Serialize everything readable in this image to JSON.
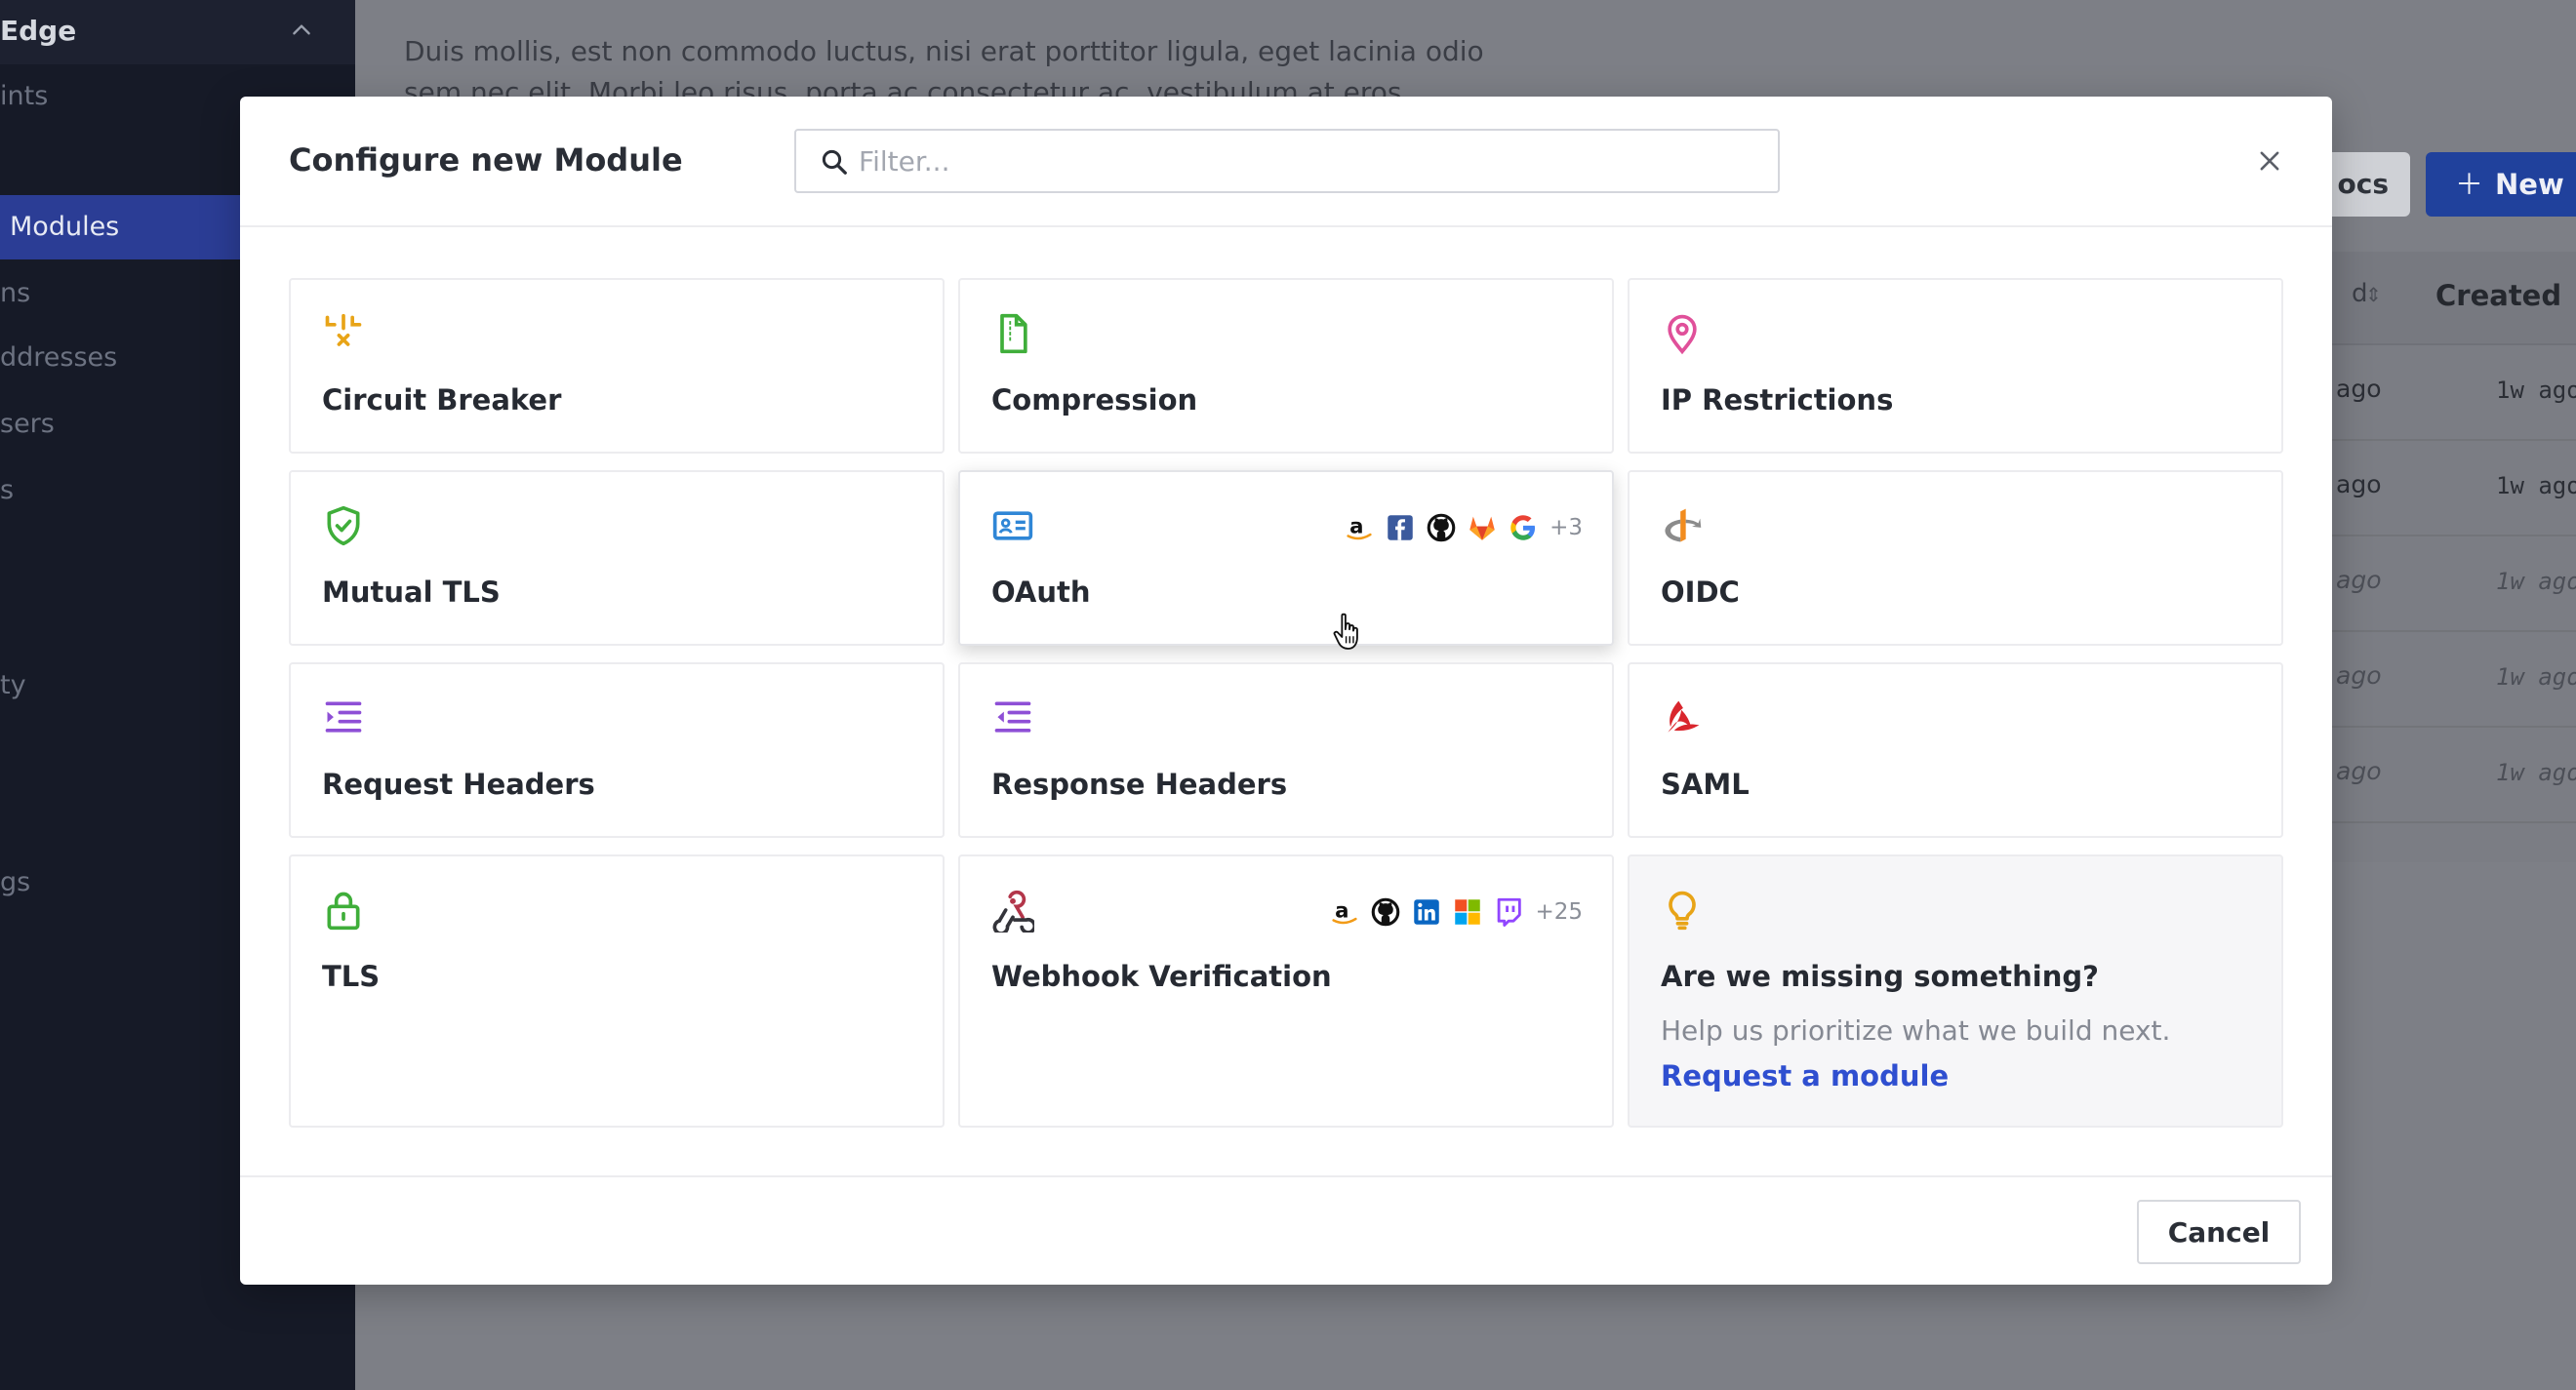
{
  "background": {
    "sidebar": {
      "header_title": "Edge",
      "items": [
        {
          "label": "ints"
        },
        {
          "label": "Modules",
          "active": true
        },
        {
          "label": "ns"
        },
        {
          "label": "ddresses"
        },
        {
          "label": "sers"
        },
        {
          "label": "s"
        },
        {
          "label": "ty"
        },
        {
          "label": "gs"
        }
      ]
    },
    "main": {
      "description_line1": "Duis mollis, est non commodo luctus, nisi erat porttitor ligula, eget lacinia odio",
      "description_line2": "sem nec elit. Morbi leo risus, porta ac consectetur ac, vestibulum at eros."
    },
    "toolbar": {
      "docs_label": "ocs",
      "new_label": "New"
    },
    "table": {
      "prev_column_fragment": "d",
      "created_header": "Created",
      "rows": [
        {
          "updated": "ago",
          "created": "1w ago"
        },
        {
          "updated": "ago",
          "created": "1w ago"
        },
        {
          "updated": "ago",
          "created": "1w ago"
        },
        {
          "updated": "ago",
          "created": "1w ago"
        },
        {
          "updated": "ago",
          "created": "1w ago"
        }
      ]
    }
  },
  "modal": {
    "title": "Configure new Module",
    "filter_placeholder": "Filter...",
    "modules": [
      {
        "title": "Circuit Breaker",
        "icon": "circuit-breaker-icon",
        "color": "#e8a417"
      },
      {
        "title": "Compression",
        "icon": "compression-file-icon",
        "color": "#3fae3a"
      },
      {
        "title": "IP Restrictions",
        "icon": "map-pin-icon",
        "color": "#e0509a"
      },
      {
        "title": "Mutual TLS",
        "icon": "shield-check-icon",
        "color": "#3fae3a"
      },
      {
        "title": "OAuth",
        "icon": "id-card-icon",
        "color": "#2f86d6",
        "providers": [
          "amazon-icon",
          "facebook-icon",
          "github-icon",
          "gitlab-icon",
          "google-icon"
        ],
        "providers_more": "+3"
      },
      {
        "title": "OIDC",
        "icon": "openid-icon",
        "color": "#f28c1e"
      },
      {
        "title": "Request Headers",
        "icon": "indent-list-icon",
        "color": "#8e4fd6"
      },
      {
        "title": "Response Headers",
        "icon": "outdent-list-icon",
        "color": "#8e4fd6"
      },
      {
        "title": "SAML",
        "icon": "saml-icon",
        "color": "#d9262d"
      },
      {
        "title": "TLS",
        "icon": "lock-icon",
        "color": "#3fae3a"
      },
      {
        "title": "Webhook Verification",
        "icon": "webhook-icon",
        "color": "#b3364a",
        "providers": [
          "amazon-icon",
          "github-icon",
          "linkedin-icon",
          "microsoft-icon",
          "twitch-icon"
        ],
        "providers_more": "+25"
      }
    ],
    "missing": {
      "title": "Are we missing something?",
      "description": "Help us prioritize what we build next.",
      "link_label": "Request a module",
      "icon": "lightbulb-icon",
      "color": "#e8a417"
    },
    "cancel_label": "Cancel",
    "colors": {
      "link": "#2f4fd0",
      "active_nav": "#2b3d95",
      "primary_button": "#20419c"
    }
  }
}
